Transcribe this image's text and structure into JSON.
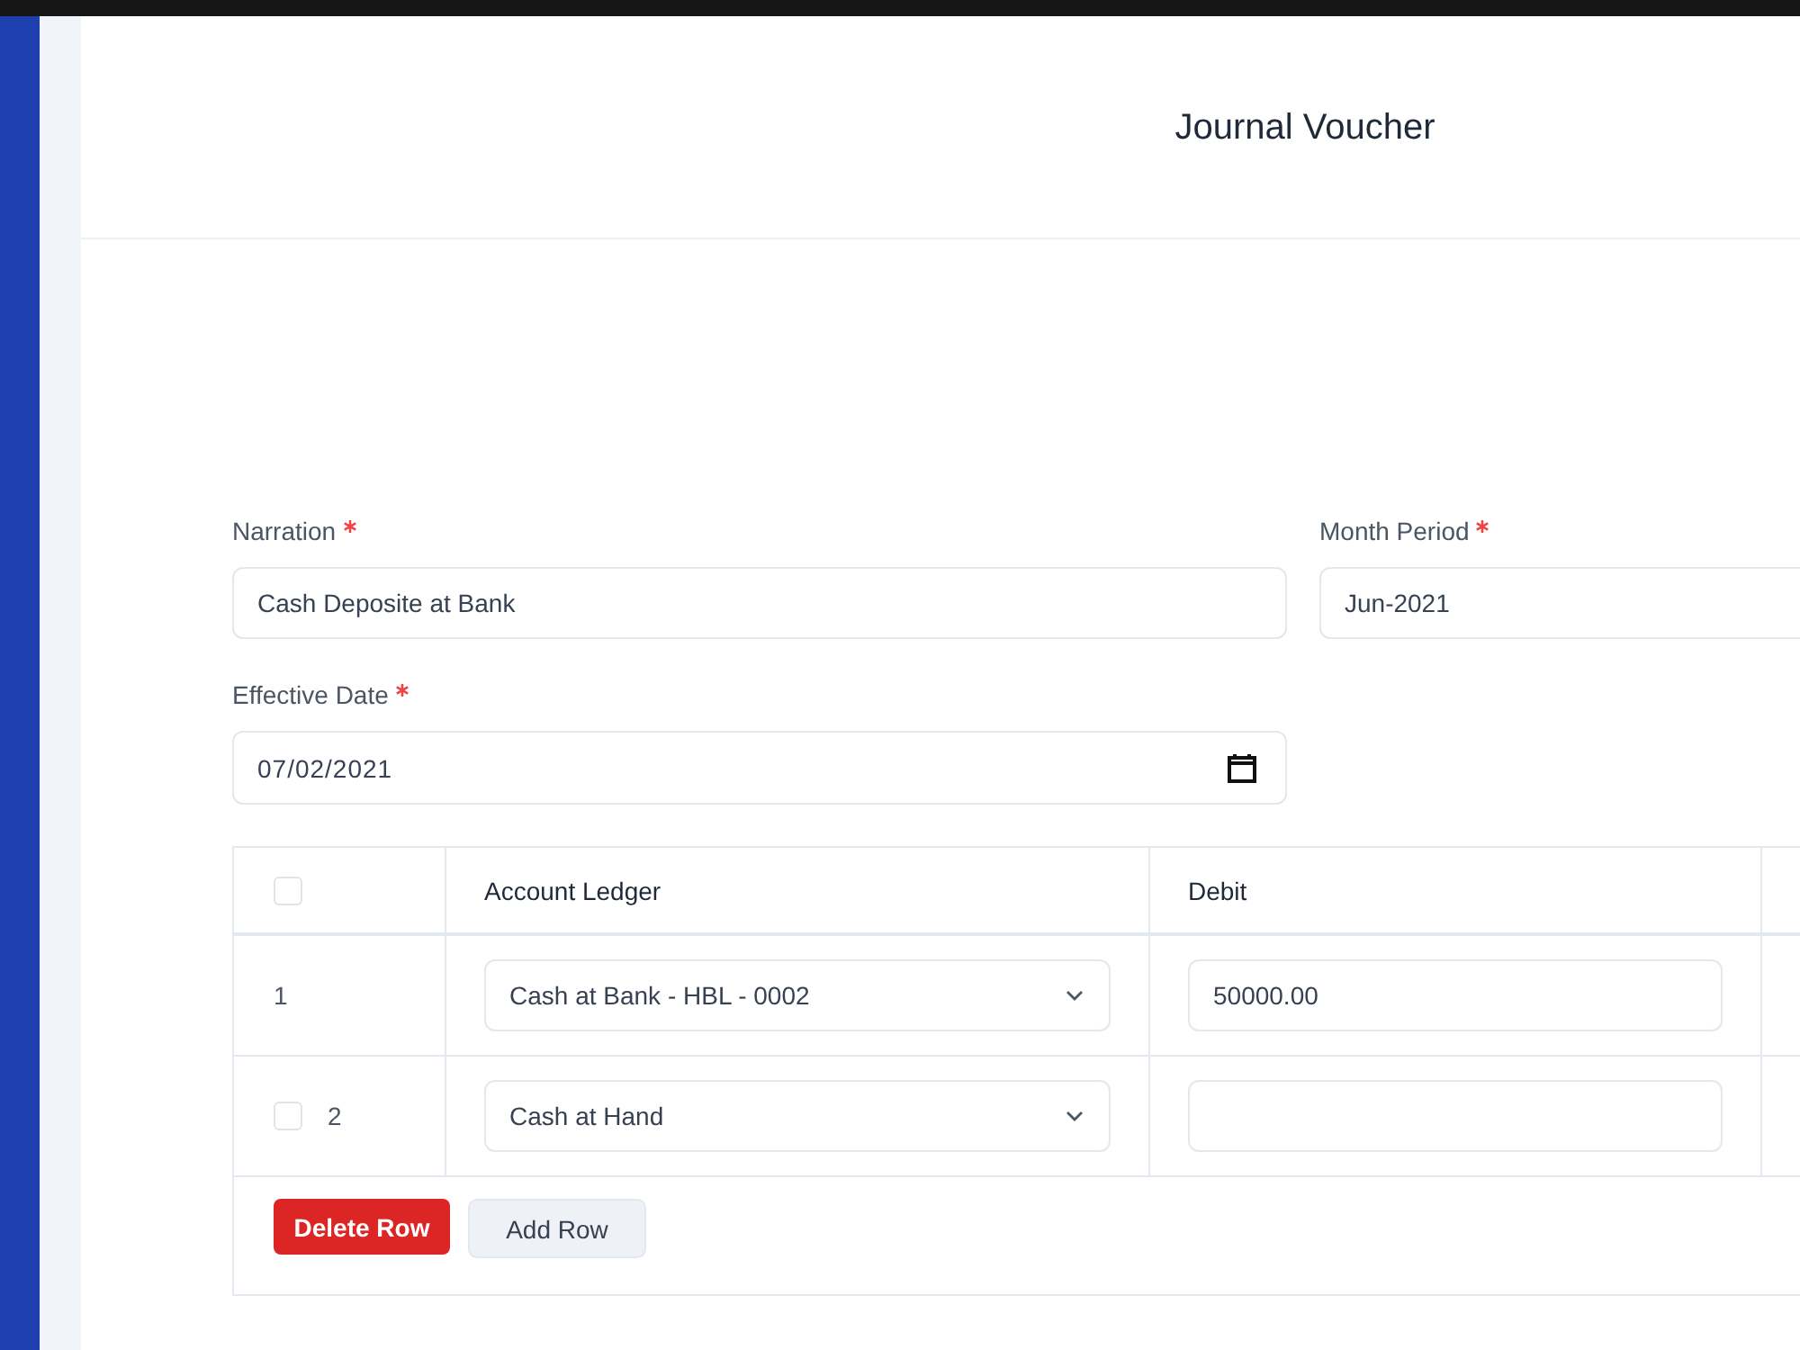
{
  "header": {
    "title": "Journal Voucher"
  },
  "form": {
    "fields": [
      {
        "kind": "text",
        "label": "Narration",
        "required": true,
        "value": "Cash Deposite at Bank"
      },
      {
        "kind": "text",
        "label": "Month Period",
        "required": true,
        "value": "Jun-2021"
      },
      {
        "kind": "date",
        "label": "Effective Date",
        "required": true,
        "value": "07/02/2021"
      }
    ]
  },
  "table": {
    "select_all": {
      "checked": false
    },
    "columns": [
      {
        "kind": "select",
        "label": "Account Ledger"
      },
      {
        "kind": "amount",
        "label": "Debit"
      }
    ],
    "rows": [
      {
        "number": "1",
        "account": "Cash at Bank - HBL - 0002",
        "debit": "50000.00"
      },
      {
        "number": "2",
        "checked": false,
        "account": "Cash at Hand"
      }
    ],
    "buttons": [
      {
        "kind": "danger",
        "label": "Delete Row"
      },
      {
        "kind": "secondary",
        "label": "Add Row"
      }
    ]
  }
}
